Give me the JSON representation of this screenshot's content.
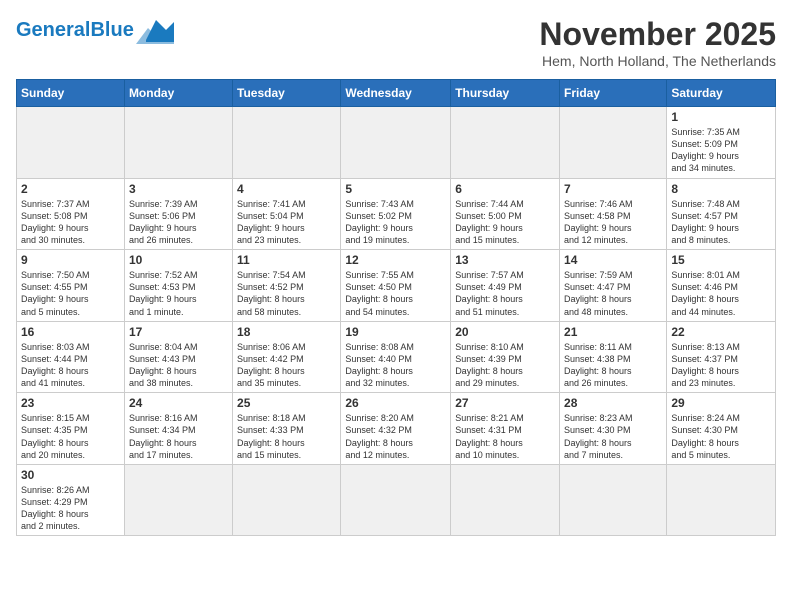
{
  "header": {
    "logo_general": "General",
    "logo_blue": "Blue",
    "title": "November 2025",
    "subtitle": "Hem, North Holland, The Netherlands"
  },
  "weekdays": [
    "Sunday",
    "Monday",
    "Tuesday",
    "Wednesday",
    "Thursday",
    "Friday",
    "Saturday"
  ],
  "weeks": [
    [
      {
        "day": "",
        "info": "",
        "empty": true
      },
      {
        "day": "",
        "info": "",
        "empty": true
      },
      {
        "day": "",
        "info": "",
        "empty": true
      },
      {
        "day": "",
        "info": "",
        "empty": true
      },
      {
        "day": "",
        "info": "",
        "empty": true
      },
      {
        "day": "",
        "info": "",
        "empty": true
      },
      {
        "day": "1",
        "info": "Sunrise: 7:35 AM\nSunset: 5:09 PM\nDaylight: 9 hours\nand 34 minutes."
      }
    ],
    [
      {
        "day": "2",
        "info": "Sunrise: 7:37 AM\nSunset: 5:08 PM\nDaylight: 9 hours\nand 30 minutes."
      },
      {
        "day": "3",
        "info": "Sunrise: 7:39 AM\nSunset: 5:06 PM\nDaylight: 9 hours\nand 26 minutes."
      },
      {
        "day": "4",
        "info": "Sunrise: 7:41 AM\nSunset: 5:04 PM\nDaylight: 9 hours\nand 23 minutes."
      },
      {
        "day": "5",
        "info": "Sunrise: 7:43 AM\nSunset: 5:02 PM\nDaylight: 9 hours\nand 19 minutes."
      },
      {
        "day": "6",
        "info": "Sunrise: 7:44 AM\nSunset: 5:00 PM\nDaylight: 9 hours\nand 15 minutes."
      },
      {
        "day": "7",
        "info": "Sunrise: 7:46 AM\nSunset: 4:58 PM\nDaylight: 9 hours\nand 12 minutes."
      },
      {
        "day": "8",
        "info": "Sunrise: 7:48 AM\nSunset: 4:57 PM\nDaylight: 9 hours\nand 8 minutes."
      }
    ],
    [
      {
        "day": "9",
        "info": "Sunrise: 7:50 AM\nSunset: 4:55 PM\nDaylight: 9 hours\nand 5 minutes."
      },
      {
        "day": "10",
        "info": "Sunrise: 7:52 AM\nSunset: 4:53 PM\nDaylight: 9 hours\nand 1 minute."
      },
      {
        "day": "11",
        "info": "Sunrise: 7:54 AM\nSunset: 4:52 PM\nDaylight: 8 hours\nand 58 minutes."
      },
      {
        "day": "12",
        "info": "Sunrise: 7:55 AM\nSunset: 4:50 PM\nDaylight: 8 hours\nand 54 minutes."
      },
      {
        "day": "13",
        "info": "Sunrise: 7:57 AM\nSunset: 4:49 PM\nDaylight: 8 hours\nand 51 minutes."
      },
      {
        "day": "14",
        "info": "Sunrise: 7:59 AM\nSunset: 4:47 PM\nDaylight: 8 hours\nand 48 minutes."
      },
      {
        "day": "15",
        "info": "Sunrise: 8:01 AM\nSunset: 4:46 PM\nDaylight: 8 hours\nand 44 minutes."
      }
    ],
    [
      {
        "day": "16",
        "info": "Sunrise: 8:03 AM\nSunset: 4:44 PM\nDaylight: 8 hours\nand 41 minutes."
      },
      {
        "day": "17",
        "info": "Sunrise: 8:04 AM\nSunset: 4:43 PM\nDaylight: 8 hours\nand 38 minutes."
      },
      {
        "day": "18",
        "info": "Sunrise: 8:06 AM\nSunset: 4:42 PM\nDaylight: 8 hours\nand 35 minutes."
      },
      {
        "day": "19",
        "info": "Sunrise: 8:08 AM\nSunset: 4:40 PM\nDaylight: 8 hours\nand 32 minutes."
      },
      {
        "day": "20",
        "info": "Sunrise: 8:10 AM\nSunset: 4:39 PM\nDaylight: 8 hours\nand 29 minutes."
      },
      {
        "day": "21",
        "info": "Sunrise: 8:11 AM\nSunset: 4:38 PM\nDaylight: 8 hours\nand 26 minutes."
      },
      {
        "day": "22",
        "info": "Sunrise: 8:13 AM\nSunset: 4:37 PM\nDaylight: 8 hours\nand 23 minutes."
      }
    ],
    [
      {
        "day": "23",
        "info": "Sunrise: 8:15 AM\nSunset: 4:35 PM\nDaylight: 8 hours\nand 20 minutes."
      },
      {
        "day": "24",
        "info": "Sunrise: 8:16 AM\nSunset: 4:34 PM\nDaylight: 8 hours\nand 17 minutes."
      },
      {
        "day": "25",
        "info": "Sunrise: 8:18 AM\nSunset: 4:33 PM\nDaylight: 8 hours\nand 15 minutes."
      },
      {
        "day": "26",
        "info": "Sunrise: 8:20 AM\nSunset: 4:32 PM\nDaylight: 8 hours\nand 12 minutes."
      },
      {
        "day": "27",
        "info": "Sunrise: 8:21 AM\nSunset: 4:31 PM\nDaylight: 8 hours\nand 10 minutes."
      },
      {
        "day": "28",
        "info": "Sunrise: 8:23 AM\nSunset: 4:30 PM\nDaylight: 8 hours\nand 7 minutes."
      },
      {
        "day": "29",
        "info": "Sunrise: 8:24 AM\nSunset: 4:30 PM\nDaylight: 8 hours\nand 5 minutes."
      }
    ],
    [
      {
        "day": "30",
        "info": "Sunrise: 8:26 AM\nSunset: 4:29 PM\nDaylight: 8 hours\nand 2 minutes."
      },
      {
        "day": "",
        "info": "",
        "empty": true
      },
      {
        "day": "",
        "info": "",
        "empty": true
      },
      {
        "day": "",
        "info": "",
        "empty": true
      },
      {
        "day": "",
        "info": "",
        "empty": true
      },
      {
        "day": "",
        "info": "",
        "empty": true
      },
      {
        "day": "",
        "info": "",
        "empty": true
      }
    ]
  ]
}
